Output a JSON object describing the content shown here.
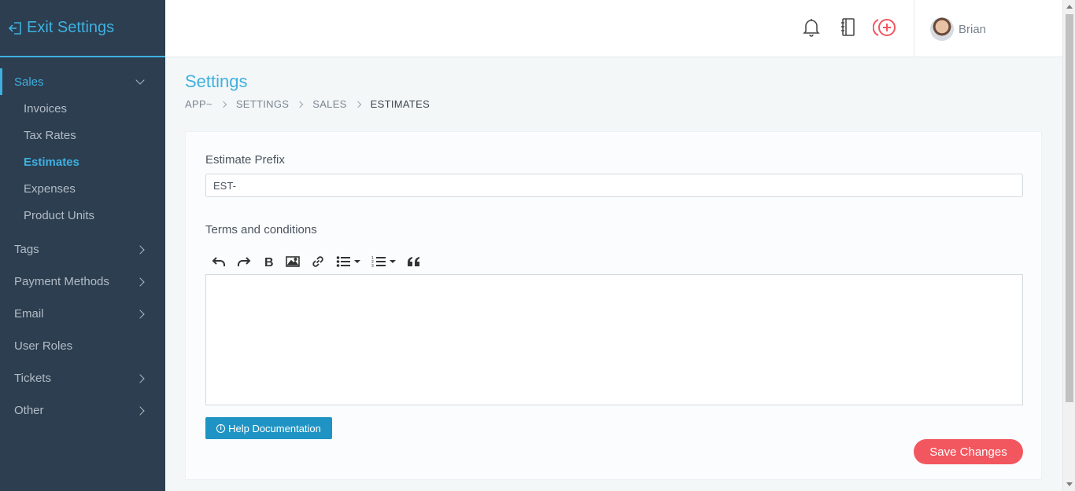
{
  "sidebar": {
    "exit_label": "Exit Settings",
    "sales": {
      "label": "Sales",
      "items": [
        "Invoices",
        "Tax Rates",
        "Estimates",
        "Expenses",
        "Product Units"
      ]
    },
    "groups": [
      "Tags",
      "Payment Methods",
      "Email",
      "User Roles",
      "Tickets",
      "Other"
    ]
  },
  "header": {
    "user_name": "Brian"
  },
  "page": {
    "title": "Settings",
    "breadcrumb": [
      "APP~",
      "SETTINGS",
      "SALES",
      "ESTIMATES"
    ]
  },
  "form": {
    "prefix_label": "Estimate Prefix",
    "prefix_value": "EST-",
    "terms_label": "Terms and conditions",
    "help_label": "Help Documentation",
    "save_label": "Save Changes"
  },
  "colors": {
    "accent": "#3fb0e0",
    "sidebar_bg": "#2c3e50",
    "save_button": "#f2575f",
    "help_button": "#1f94c4"
  }
}
